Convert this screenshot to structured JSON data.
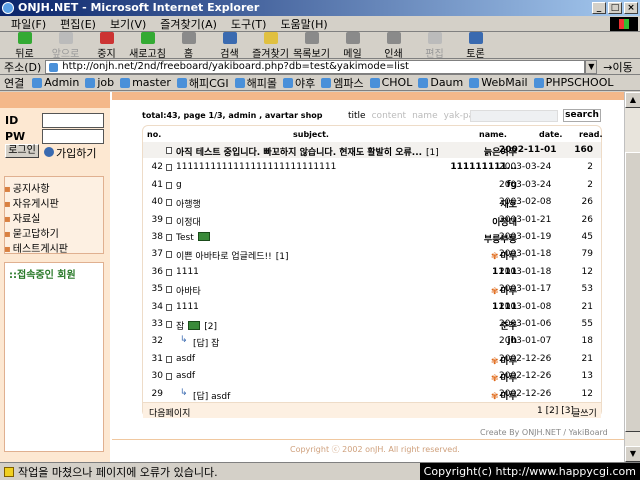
{
  "window": {
    "title": "ONJH.NET - Microsoft Internet Explorer"
  },
  "menubar": [
    "파일(F)",
    "편집(E)",
    "보기(V)",
    "즐겨찾기(A)",
    "도구(T)",
    "도움말(H)"
  ],
  "toolbar": [
    {
      "label": "뒤로",
      "icon": "back-arrow-icon",
      "disabled": false
    },
    {
      "label": "앞으로",
      "icon": "forward-arrow-icon",
      "disabled": true
    },
    {
      "label": "중지",
      "icon": "stop-icon",
      "disabled": false
    },
    {
      "label": "새로고침",
      "icon": "refresh-icon",
      "disabled": false
    },
    {
      "label": "홈",
      "icon": "home-icon",
      "disabled": false
    },
    {
      "label": "검색",
      "icon": "search-icon",
      "disabled": false
    },
    {
      "label": "즐겨찾기",
      "icon": "favorites-icon",
      "disabled": false
    },
    {
      "label": "목록보기",
      "icon": "history-icon",
      "disabled": false
    },
    {
      "label": "메일",
      "icon": "mail-icon",
      "disabled": false
    },
    {
      "label": "인쇄",
      "icon": "print-icon",
      "disabled": false
    },
    {
      "label": "편집",
      "icon": "edit-icon",
      "disabled": true
    },
    {
      "label": "토론",
      "icon": "discuss-icon",
      "disabled": false
    }
  ],
  "address": {
    "label": "주소(D)",
    "url": "http://onjh.net/2nd/freeboard/yakiboard.php?db=test&yakimode=list",
    "go": "이동"
  },
  "links": {
    "label": "연결",
    "items": [
      "Admin",
      "job",
      "master",
      "해피CGI",
      "해피몰",
      "야후",
      "엠파스",
      "CHOL",
      "Daum",
      "WebMail",
      "PHPSCHOOL"
    ]
  },
  "sidebar": {
    "id_label": "ID",
    "pw_label": "PW",
    "login_button": "로그인",
    "join_link": "가입하기",
    "menu": [
      "공지사항",
      "자유게시판",
      "자료실",
      "묻고답하기",
      "테스트게시판"
    ],
    "online_title": "::접속중인 회원"
  },
  "board": {
    "info": "total:43, page 1/3, admin , avartar shop",
    "search_options": [
      "title",
      "content",
      "name",
      "yak-party"
    ],
    "search_button": "search",
    "headers": {
      "no": "no.",
      "subject": "subject.",
      "name": "name.",
      "date": "date.",
      "read": "read."
    },
    "rows": [
      {
        "no": "",
        "subject": "아직 테스트 중입니다. 빠꼬하지 않습니다. 현재도 활발히 오류...",
        "comments": "[1]",
        "name": "늙은여우",
        "date": "2002-11-01",
        "read": "160",
        "notice": true
      },
      {
        "no": "42",
        "subject": "1111111111111111111111111111",
        "comments": "",
        "name": "111111111...",
        "date": "2003-03-24",
        "read": "2"
      },
      {
        "no": "41",
        "subject": "g",
        "comments": "",
        "name": "fg",
        "date": "2003-03-24",
        "read": "2"
      },
      {
        "no": "40",
        "subject": "아행행",
        "comments": "",
        "name": "재호",
        "date": "2003-02-08",
        "read": "26"
      },
      {
        "no": "39",
        "subject": "이정대",
        "comments": "",
        "name": "이정대",
        "date": "2003-01-21",
        "read": "26"
      },
      {
        "no": "38",
        "subject": "Test",
        "comments": "",
        "name": "부릉부릉",
        "date": "2003-01-19",
        "read": "45",
        "image": true
      },
      {
        "no": "37",
        "subject": "이쁜 아바타로 업글레드!!",
        "comments": "[1]",
        "name": "마루",
        "date": "2003-01-18",
        "read": "79",
        "mark": true
      },
      {
        "no": "36",
        "subject": "1111",
        "comments": "",
        "name": "1111",
        "date": "2003-01-18",
        "read": "12"
      },
      {
        "no": "35",
        "subject": "아바타",
        "comments": "",
        "name": "마루",
        "date": "2003-01-17",
        "read": "53",
        "mark": true
      },
      {
        "no": "34",
        "subject": "1111",
        "comments": "",
        "name": "1111",
        "date": "2003-01-08",
        "read": "21"
      },
      {
        "no": "33",
        "subject": "잡",
        "comments": "[2]",
        "name": "준주",
        "date": "2003-01-06",
        "read": "55",
        "image": true
      },
      {
        "no": "32",
        "subject": "[답] 잡",
        "comments": "",
        "name": "jh",
        "date": "2003-01-07",
        "read": "18",
        "reply": true
      },
      {
        "no": "31",
        "subject": "asdf",
        "comments": "",
        "name": "마루",
        "date": "2002-12-26",
        "read": "21",
        "mark": true
      },
      {
        "no": "30",
        "subject": "asdf",
        "comments": "",
        "name": "마루",
        "date": "2002-12-26",
        "read": "13",
        "mark": true
      },
      {
        "no": "29",
        "subject": "[답] asdf",
        "comments": "",
        "name": "마루",
        "date": "2002-12-26",
        "read": "12",
        "reply": true,
        "mark": true
      }
    ],
    "next_page": "다음페이지",
    "pages": "1 [2] [3]",
    "write": "글쓰기",
    "credit": "Create By ONJH.NET / YakiBoard",
    "copyright": "Copyright ⓒ 2002 onJH. All right reserved."
  },
  "status": {
    "text": "작업을 마쳤으나 페이지에 오류가 있습니다.",
    "site": "Copyright(c) http://www.happycgi.com"
  }
}
